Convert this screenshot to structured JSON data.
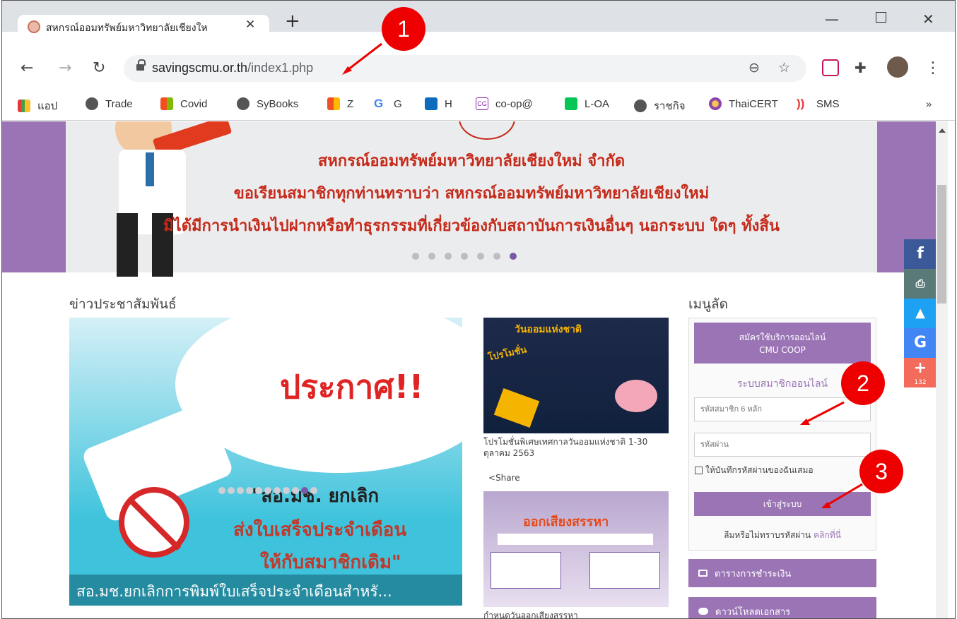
{
  "browser": {
    "tab_title": "สหกรณ์ออมทรัพย์มหาวิทยาลัยเชียงให",
    "url_host": "savingscmu.or.th",
    "url_path": "/index1.php",
    "bookmarks": [
      {
        "label": "แอป",
        "icon": "apps-grid-icon"
      },
      {
        "label": "Trade",
        "icon": "globe-icon"
      },
      {
        "label": "Covid",
        "icon": "windows-logo-icon"
      },
      {
        "label": "SyBooks",
        "icon": "globe-icon"
      },
      {
        "label": "Z",
        "icon": "windows-logo-icon"
      },
      {
        "label": "G",
        "icon": "google-g-icon"
      },
      {
        "label": "H",
        "icon": "outlook-icon"
      },
      {
        "label": "co-op@",
        "icon": "cg-icon"
      },
      {
        "label": "L-OA",
        "icon": "line-icon"
      },
      {
        "label": "ราชกิจ",
        "icon": "globe-icon"
      },
      {
        "label": "ThaiCERT",
        "icon": "thaicert-icon"
      },
      {
        "label": "SMS",
        "icon": "rss-icon"
      }
    ],
    "more": "»"
  },
  "banner": {
    "line1": "สหกรณ์ออมทรัพย์มหาวิทยาลัยเชียงใหม่ จำกัด",
    "line2": "ขอเรียนสมาชิกทุกท่านทราบว่า สหกรณ์ออมทรัพย์มหาวิทยาลัยเชียงใหม่",
    "line3": "มิได้มีการนำเงินไปฝากหรือทำธุรกรรมที่เกี่ยวข้องกับสถาบันการเงินอื่นๆ นอกระบบ ใดๆ ทั้งสิ้น"
  },
  "news": {
    "title": "ข่าวประชาสัมพันธ์",
    "hero_heading": "ประกาศ!!",
    "hero_line1": "\"สอ.มช. ยกเลิก",
    "hero_line2": "ส่งใบเสร็จประจำเดือน",
    "hero_line3": "ให้กับสมาชิกเดิม\"",
    "hero_caption": "สอ.มช.ยกเลิกการพิมพ์ใบเสร็จประจำเดือนสำหรั...",
    "item1_caption": "โปรโมชั่นพิเศษเทศกาลวันออมแห่งชาติ 1-30 ตุลาคม 2563",
    "item1_img_title": "วันออมแห่งชาติ",
    "item1_img_promo": "โปรโมชั่น",
    "share": "Share",
    "item2_img_title": "ออกเสียงสรรหา",
    "item2_caption": "กำหนดวันออกเสียงสรรหา"
  },
  "quickmenu": {
    "title": "เมนูลัด",
    "register_line1": "สมัครใช้บริการออนไลน์",
    "register_line2": "CMU COOP",
    "member_system": "ระบบสมาชิกออนไลน์",
    "member_id_placeholder": "รหัสสมาชิก 6 หลัก",
    "password_placeholder": "รหัสผ่าน",
    "remember": "ให้บันทึกรหัสผ่านของฉันเสมอ",
    "login": "เข้าสู่ระบบ",
    "forgot": "ลืมหรือไม่ทราบรหัสผ่าน",
    "forgot_link": "คลิกที่นี่",
    "menu1": "ตารางการชำระเงิน",
    "menu2": "ดาวน์โหลดเอกสาร"
  },
  "social": {
    "share_count": "132"
  },
  "annotations": [
    "1",
    "2",
    "3"
  ],
  "colors": {
    "accent_purple": "#9a74b5",
    "banner_red": "#c52a1a",
    "annotation_red": "#ee0000"
  }
}
